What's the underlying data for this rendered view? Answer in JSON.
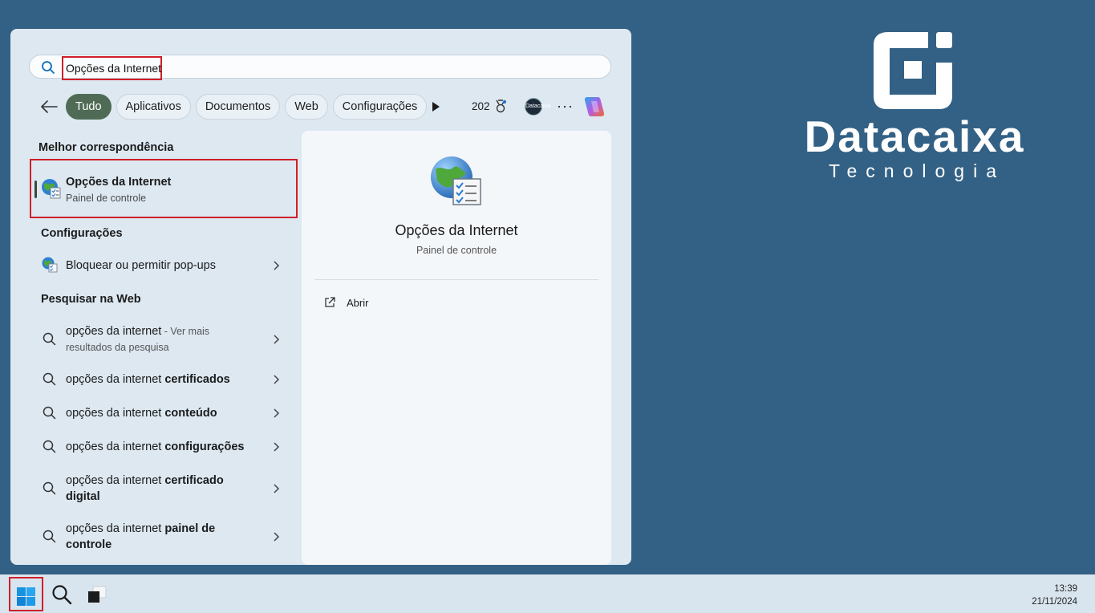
{
  "search": {
    "value": "Opções da Internet"
  },
  "filters": {
    "tabs": [
      {
        "label": "Tudo",
        "active": true
      },
      {
        "label": "Aplicativos"
      },
      {
        "label": "Documentos"
      },
      {
        "label": "Web"
      },
      {
        "label": "Configurações"
      }
    ],
    "points": "202",
    "avatar_text": "Datacaixa",
    "more": "···"
  },
  "results": {
    "best_title": "Melhor correspondência",
    "best": {
      "name": "Opções da Internet",
      "sub": "Painel de controle"
    },
    "settings_title": "Configurações",
    "settings": [
      {
        "label": "Bloquear ou permitir pop-ups"
      }
    ],
    "web_title": "Pesquisar na Web",
    "web": [
      {
        "prefix": "opções da internet",
        "bold": "",
        "suffix": " - Ver mais",
        "line2": "resultados da pesquisa"
      },
      {
        "prefix": "opções da internet ",
        "bold": "certificados"
      },
      {
        "prefix": "opções da internet ",
        "bold": "conteúdo"
      },
      {
        "prefix": "opções da internet ",
        "bold": "configurações"
      },
      {
        "prefix": "opções da internet ",
        "bold": "certificado",
        "bold2": "digital"
      },
      {
        "prefix": "opções da internet ",
        "bold": "painel de",
        "bold2": "controle"
      }
    ]
  },
  "preview": {
    "title": "Opções da Internet",
    "sub": "Painel de controle",
    "open": "Abrir"
  },
  "logo": {
    "name": "Datacaixa",
    "sub": "Tecnologia"
  },
  "clock": {
    "time": "13:39",
    "date": "21/11/2024"
  },
  "colors": {
    "desktop": "#336185",
    "accent_red": "#d01f2a",
    "chip_active": "#4f6b55"
  }
}
